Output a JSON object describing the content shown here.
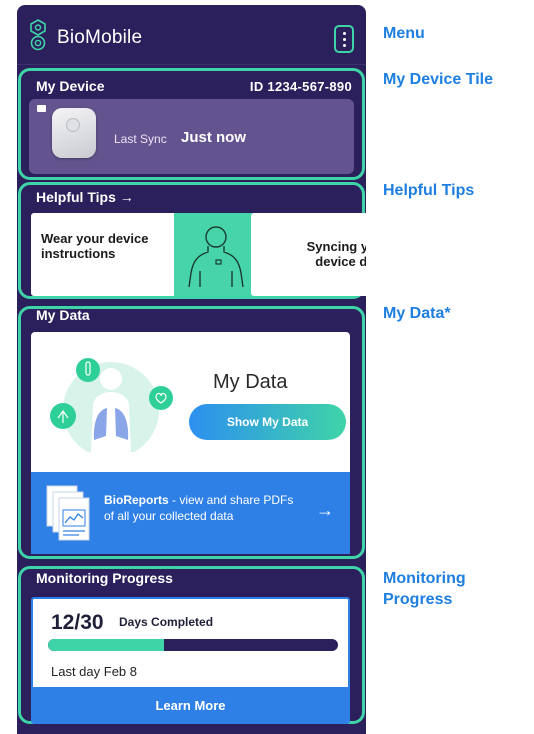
{
  "app": {
    "title": "BioMobile"
  },
  "device": {
    "title": "My Device",
    "id": "ID 1234-567-890",
    "sync_label": "Last Sync",
    "sync_value": "Just now"
  },
  "tips": {
    "title": "Helpful Tips →",
    "cards": [
      {
        "text": "Wear your device instructions"
      },
      {
        "text": "Syncing your device daily"
      }
    ]
  },
  "my_data": {
    "title": "My Data",
    "heading": "My Data",
    "button_label": "Show My Data",
    "reports_brand": "BioReports",
    "reports_text": " - view and share PDFs of all your collected data",
    "reports_arrow": "→"
  },
  "progress": {
    "title": "Monitoring Progress",
    "count": "12/30",
    "caption": "Days Completed",
    "completed": 12,
    "total": 30,
    "last_day": "Last day Feb 8",
    "button_label": "Learn More"
  },
  "callouts": {
    "menu": "Menu",
    "device": "My Device Tile",
    "tips": "Helpful Tips",
    "data": "My Data*",
    "progress_line1": "Monitoring",
    "progress_line2": "Progress"
  },
  "colors": {
    "accent": "#3fd4a8",
    "app_bg": "#2b1f5c",
    "blue": "#2f80e6",
    "callout": "#1e7fe0"
  }
}
